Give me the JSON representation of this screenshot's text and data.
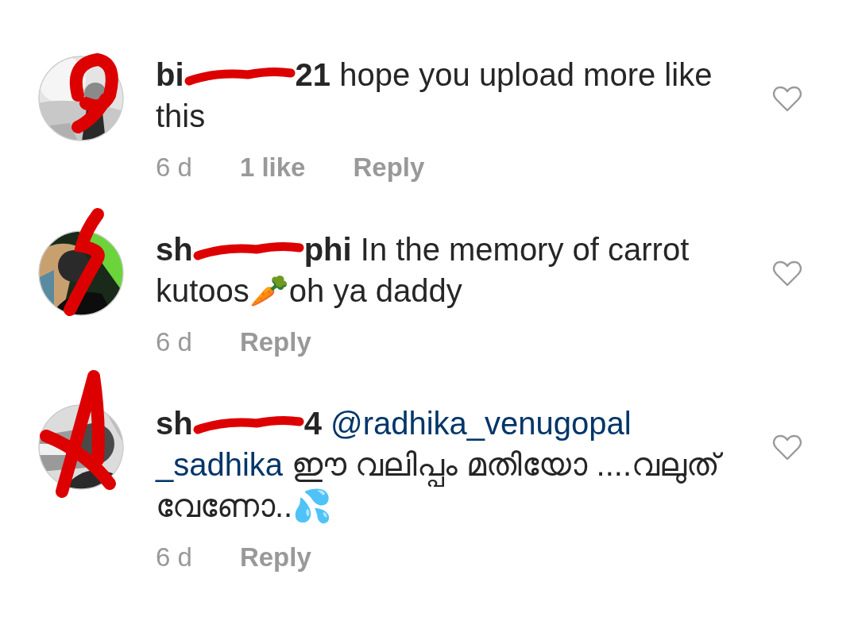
{
  "comments": [
    {
      "avatar": {
        "kind": "picture"
      },
      "username_start": "bi",
      "username_end": "21",
      "lines": [
        [
          {
            "kind": "text",
            "text": "hope you upload more like"
          }
        ],
        [
          {
            "kind": "text",
            "text": "this"
          }
        ]
      ],
      "time": "6 d",
      "likes": "1 like",
      "reply": "Reply",
      "liked": false
    },
    {
      "avatar": {
        "kind": "picture"
      },
      "username_start": "sh",
      "username_end": "phi",
      "lines": [
        [
          {
            "kind": "text",
            "text": "In the memory of carrot"
          }
        ],
        [
          {
            "kind": "text",
            "text": "kutoos🥕oh ya daddy"
          }
        ]
      ],
      "time": "6 d",
      "reply": "Reply",
      "liked": false
    },
    {
      "avatar": {
        "kind": "picture"
      },
      "username_start": "sh",
      "username_end": "4",
      "lines": [
        [
          {
            "kind": "mention",
            "text": "@radhika_venugopal"
          }
        ],
        [
          {
            "kind": "mention",
            "text": "_sadhika"
          },
          {
            "kind": "text",
            "text": "ഈ വലിപ്പം മതിയോ ....വലുത്"
          }
        ],
        [
          {
            "kind": "text",
            "text": "വേണോ..💦"
          }
        ]
      ],
      "time": "6 d",
      "reply": "Reply",
      "liked": false
    }
  ]
}
